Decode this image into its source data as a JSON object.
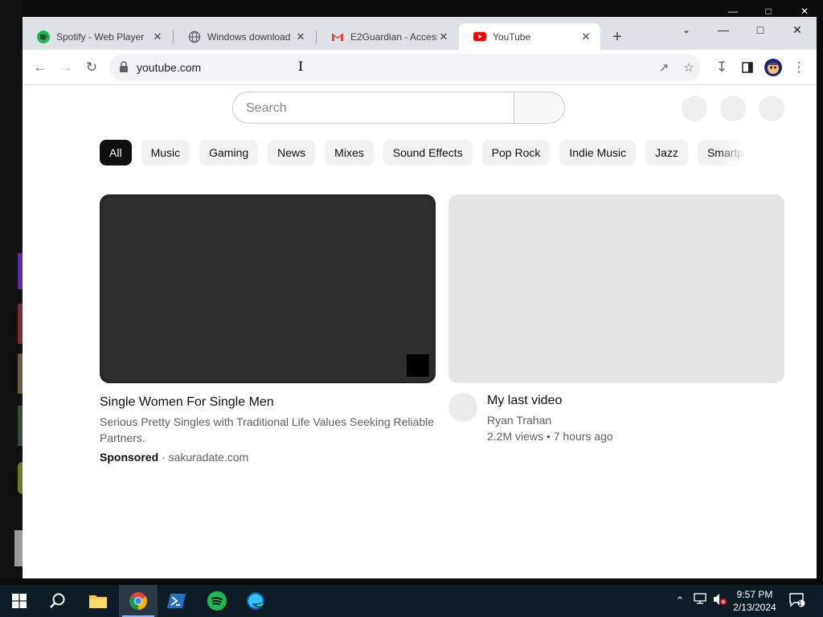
{
  "browser": {
    "tabs": [
      {
        "title": "Spotify - Web Player",
        "icon": "spotify-icon",
        "active": false
      },
      {
        "title": "Windows download -",
        "icon": "globe-icon",
        "active": false
      },
      {
        "title": "E2Guardian - Access",
        "icon": "gmail-icon",
        "active": false
      },
      {
        "title": "YouTube",
        "icon": "youtube-icon",
        "active": true
      }
    ],
    "address": "youtube.com"
  },
  "youtube": {
    "search_placeholder": "Search",
    "chips": [
      "All",
      "Music",
      "Gaming",
      "News",
      "Mixes",
      "Sound Effects",
      "Pop Rock",
      "Indie Music",
      "Jazz",
      "Smartphones"
    ],
    "active_chip": "All",
    "videos": [
      {
        "title": "Single Women For Single Men",
        "description": "Serious Pretty Singles with Traditional Life Values Seeking Reliable Partners.",
        "sponsored_label": "Sponsored",
        "advertiser": "sakuradate.com"
      },
      {
        "title": "My last video",
        "channel": "Ryan Trahan",
        "stats": "2.2M views • 7 hours ago"
      }
    ]
  },
  "taskbar": {
    "time": "9:57 PM",
    "date": "2/13/2024",
    "notification_count": "1"
  },
  "colors": {
    "youtube_red": "#ff0000",
    "spotify_green": "#1db954",
    "taskbar_bg": "#0e1c26"
  }
}
